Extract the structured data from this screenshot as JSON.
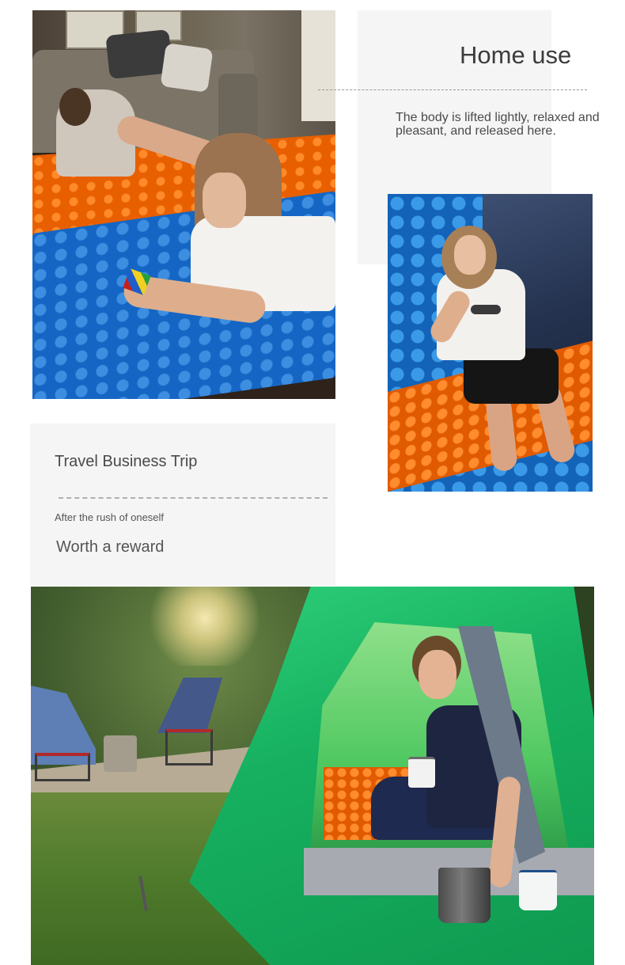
{
  "home": {
    "title": "Home use",
    "description": "The body is lifted lightly, relaxed and pleasant, and released here."
  },
  "travel": {
    "title": "Travel Business Trip",
    "subtitle": "After the rush of oneself",
    "reward": "Worth a reward"
  },
  "colors": {
    "panel_bg": "#f5f5f5",
    "mat_orange": "#e85f00",
    "mat_blue": "#1566c4",
    "tent_green": "#16b060"
  }
}
